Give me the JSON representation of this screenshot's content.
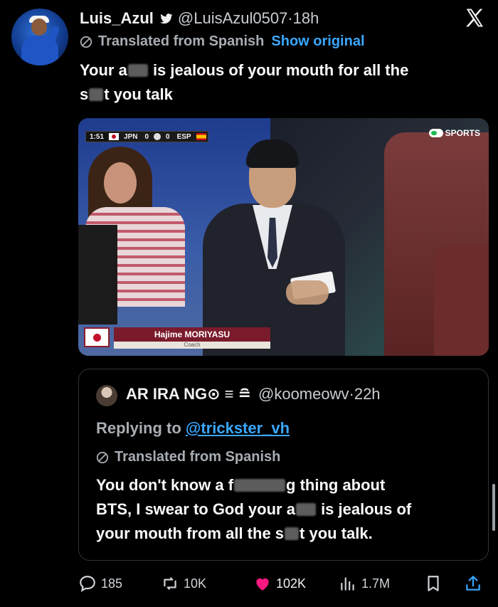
{
  "tweet": {
    "display_name": "Luis_Azul",
    "handle": "@LuisAzul0507",
    "separator": "·",
    "time": "18h",
    "translated_label": "Translated from Spanish",
    "show_original": "Show original",
    "text_a": "Your a",
    "text_b": " is jealous of your mouth for all the",
    "text_c": "s",
    "text_d": "t you talk"
  },
  "media": {
    "scoreboard": {
      "clock": "1:51",
      "team_home": "JPN",
      "score_home": "0",
      "score_away": "0",
      "team_away": "ESP"
    },
    "broadcaster": "SPORTS",
    "caption_name": "Hajime MORIYASU",
    "caption_role": "Coach"
  },
  "quoted": {
    "display_name": "AR IRA NG⊙ ≡ ≘",
    "handle": "@koomeowv",
    "separator": "·",
    "time": "22h",
    "replying_prefix": "Replying to ",
    "replying_mention": "@trickster_vh",
    "translated_label": "Translated from Spanish",
    "line1_a": "You don't know a f",
    "line1_b": "g thing about",
    "line2_a": "BTS, I swear to God your a",
    "line2_b": " is jealous of",
    "line3_a": "your mouth from all the s",
    "line3_b": "t you talk."
  },
  "actions": {
    "replies": "185",
    "retweets": "10K",
    "likes": "102K",
    "views": "1.7M"
  },
  "colors": {
    "accent": "#3aa7ff",
    "like": "#f91880",
    "background": "#000000"
  },
  "icons": [
    "verified-icon",
    "x-logo-icon",
    "translate-icon",
    "reply-icon",
    "retweet-icon",
    "heart-icon",
    "views-icon",
    "bookmark-icon",
    "share-icon"
  ]
}
